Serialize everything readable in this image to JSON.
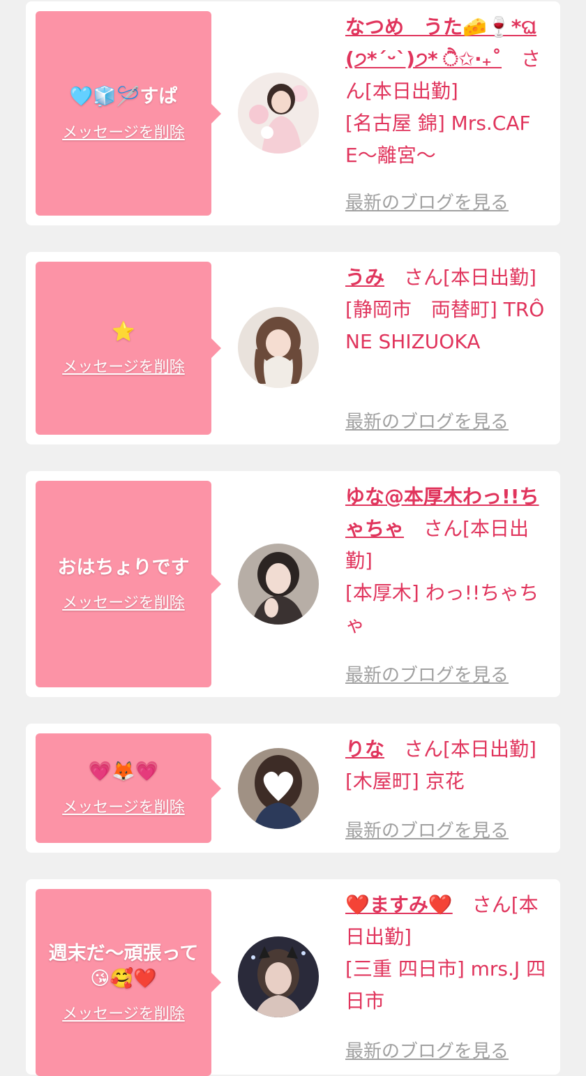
{
  "common": {
    "delete_label": "メッセージを削除",
    "blog_label": "最新のブログを見る"
  },
  "entries": [
    {
      "message": "🩵🧊🪡すぱ",
      "name": "なつめ　うた🧀🍷*ଘ(੭*ˊᵕˋ)੭* ੈ✩‧₊˚",
      "suffix": "　さん[本日出勤]",
      "shop": "[名古屋 錦] Mrs.CAFE〜離宮〜"
    },
    {
      "message": "⭐️",
      "name": "うみ",
      "suffix": "　さん[本日出勤]",
      "shop": "[静岡市　両替町] TRÔNE SHIZUOKA"
    },
    {
      "message": "おはちょりです",
      "name": "ゆな@本厚木わっ!!ちゃちゃ",
      "suffix": "　さん[本日出勤]",
      "shop": "[本厚木] わっ!!ちゃちゃ"
    },
    {
      "message": "💗🦊💗",
      "name": "りな",
      "suffix": "　さん[本日出勤]",
      "shop": "[木屋町] 京花"
    },
    {
      "message": "週末だ〜頑張って😘🥰❤️",
      "name": "❤️ますみ❤️",
      "suffix": "　さん[本日出勤]",
      "shop": "[三重 四日市] mrs.J 四日市"
    }
  ]
}
